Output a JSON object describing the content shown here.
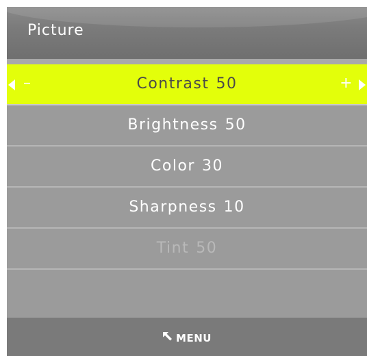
{
  "menu": {
    "title": "Picture"
  },
  "selected_row": {
    "label": "Contrast",
    "value": "50",
    "decrease_symbol": "–",
    "increase_symbol": "+"
  },
  "items": [
    {
      "label": "Brightness",
      "value": "50",
      "enabled": true
    },
    {
      "label": "Color",
      "value": "30",
      "enabled": true
    },
    {
      "label": "Sharpness",
      "value": "10",
      "enabled": true
    },
    {
      "label": "Tint",
      "value": "50",
      "enabled": false
    }
  ],
  "footer": {
    "menu_label": "MENU",
    "icon": "back-arrow-icon"
  },
  "colors": {
    "highlight": "#e3ff0a",
    "panel": "#9b9b9b",
    "header": "#7b7b7b",
    "footer": "#7a7a7a",
    "disabled_text": "#b9b9b9"
  }
}
